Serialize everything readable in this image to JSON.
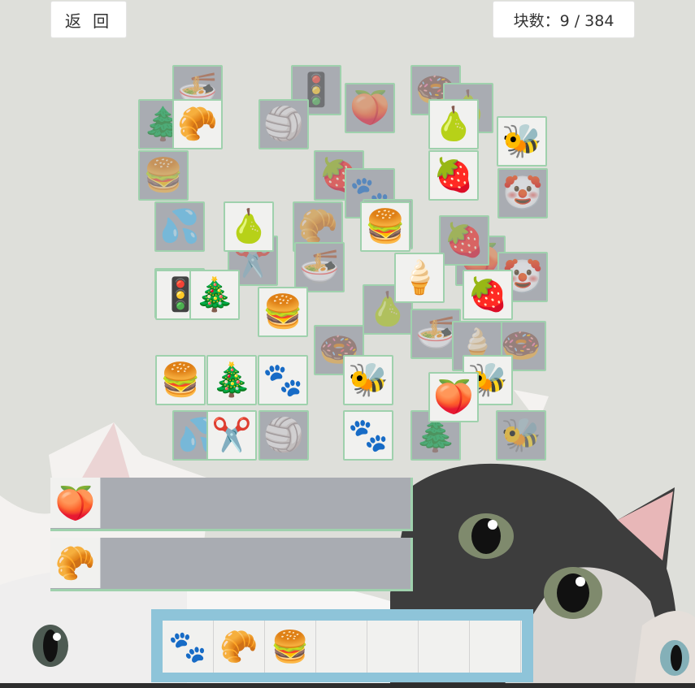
{
  "header": {
    "back_label": "返 回",
    "count_label": "块数：9 / 384"
  },
  "board_covered": [
    {
      "icon": "🍜"
    },
    {
      "icon": "🚦"
    },
    {
      "icon": "🍩"
    },
    {
      "icon": "🍑"
    },
    {
      "icon": "🏐"
    },
    {
      "icon": "🌲"
    },
    {
      "icon": "🍐"
    },
    {
      "icon": "🍔"
    },
    {
      "icon": "🍓"
    },
    {
      "icon": "🐾"
    },
    {
      "icon": "🤡"
    },
    {
      "icon": "💦"
    },
    {
      "icon": "🥐"
    },
    {
      "icon": "🍑"
    },
    {
      "icon": "✂️"
    },
    {
      "icon": "🍜"
    },
    {
      "icon": "🚦"
    },
    {
      "icon": "🍦"
    },
    {
      "icon": "🍩"
    },
    {
      "icon": "🤡"
    },
    {
      "icon": "🍐"
    },
    {
      "icon": "🍜"
    },
    {
      "icon": "🍦"
    },
    {
      "icon": "🍩"
    },
    {
      "icon": "🐝"
    },
    {
      "icon": "🌲"
    },
    {
      "icon": "💦"
    },
    {
      "icon": "🍔"
    },
    {
      "icon": "🏐"
    },
    {
      "icon": "🍓"
    }
  ],
  "board_top": [
    {
      "icon": "🥐"
    },
    {
      "icon": "🍐"
    },
    {
      "icon": "🐝"
    },
    {
      "icon": "🍓"
    },
    {
      "icon": "🍐"
    },
    {
      "icon": "🍔"
    },
    {
      "icon": "🍦"
    },
    {
      "icon": "🚦"
    },
    {
      "icon": "🎄"
    },
    {
      "icon": "🍔"
    },
    {
      "icon": "🍓"
    },
    {
      "icon": "🍔"
    },
    {
      "icon": "🎄"
    },
    {
      "icon": "🐾"
    },
    {
      "icon": "🐝"
    },
    {
      "icon": "🐝"
    },
    {
      "icon": "✂️"
    },
    {
      "icon": "🐾"
    },
    {
      "icon": "🍑"
    }
  ],
  "side_stacks": [
    {
      "icon": "🍑"
    },
    {
      "icon": "🥐"
    }
  ],
  "tray": [
    {
      "icon": "🐾"
    },
    {
      "icon": "🥐"
    },
    {
      "icon": "🍔"
    },
    {
      "icon": ""
    },
    {
      "icon": ""
    },
    {
      "icon": ""
    },
    {
      "icon": ""
    }
  ],
  "colors": {
    "tile_border": "#9fd1ad",
    "tray_frame": "#8ec4d9",
    "covered_tile": "#a9acb2",
    "top_tile": "#f1f1ef"
  }
}
